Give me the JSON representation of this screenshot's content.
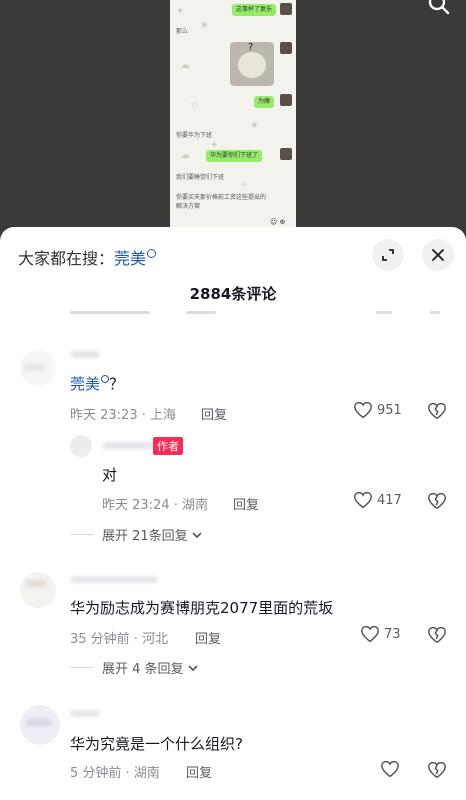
{
  "video": {
    "bubbles": [
      "这事杯了复乐",
      "为雁",
      "华为要你们下班了",
      "照片"
    ],
    "texts": [
      "那么",
      "你要华为下班",
      "我们要睡觉们下班",
      "你要买天那价格前工资这些提出的解决方案"
    ],
    "bottom_icons": "☺ ⊕"
  },
  "sheet": {
    "search_prefix": "大家都在搜：",
    "search_keyword": "莞美",
    "comment_count": "2884条评论"
  },
  "comments": [
    {
      "pre": "",
      "link": "莞美",
      "post": "？",
      "meta": "昨天 23:23 · 上海",
      "reply": "回复",
      "likes": "951"
    },
    {
      "badge": "作者",
      "text": "对",
      "meta": "昨天 23:24 · 湖南",
      "reply": "回复",
      "likes": "417"
    },
    {
      "text": "华为励志成为赛博朋克2077里面的荒坂",
      "meta": "35 分钟前 · 河北",
      "reply": "回复",
      "likes": "73"
    },
    {
      "text": "华为究竟是一个什么组织?",
      "meta": "5 分钟前 · 湖南",
      "reply": "回复",
      "likes": ""
    }
  ],
  "expand1": "展开 21条回复",
  "expand2": "展开 4 条回复"
}
